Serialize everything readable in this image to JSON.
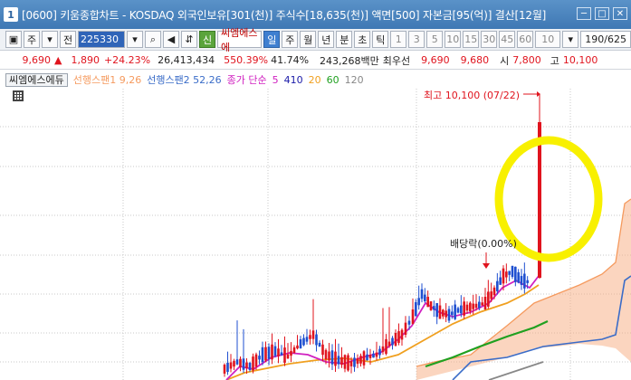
{
  "window": {
    "number": "1",
    "title": "[0600] 키움종합차트 - KOSDAQ 외국인보유[301(천)] 주식수[18,635(천)] 액면[500] 자본금[95(억)] 결산[12월]",
    "buttons": [
      "─",
      "□",
      "✕"
    ]
  },
  "toolbar": {
    "period_selects": [
      "주",
      "전"
    ],
    "stock_code": "225330",
    "stock_name": "씨엠에스에",
    "tag_new": "신",
    "intervals": [
      "일",
      "주",
      "월",
      "년",
      "분",
      "초",
      "틱"
    ],
    "selected_interval": "일",
    "minute_options": [
      "1",
      "3",
      "5",
      "10",
      "15",
      "30",
      "45",
      "60"
    ],
    "custom_minutes": "10",
    "count": "190",
    "count_total": "/625"
  },
  "quote": {
    "price": "9,690",
    "arrow": "▲",
    "change": "1,890",
    "change_pct": "+24.23%",
    "volume": "26,413,434",
    "volume_ratio": "550.39%",
    "turnover": "41.74%",
    "amount": "243,268백만",
    "best_ask_label": "최우선",
    "best_ask": "9,690",
    "best_bid": "9,680",
    "open_label": "시",
    "open": "7,800",
    "high_label": "고",
    "high": "10,100"
  },
  "legend": {
    "stock_button": "씨엠에스에듀",
    "span1": "선행스팬1 9,26",
    "span2": "선행스팬2 52,26",
    "ma_label": "종가 단순",
    "ma_periods": [
      "5",
      "410",
      "20",
      "60",
      "120"
    ],
    "colors": {
      "span1": "#f59a5e",
      "span2": "#3a6cc8",
      "ma_label": "#d020c0",
      "ma5": "#d020c0",
      "ma410": "#1a1aa8",
      "ma20": "#f0a020",
      "ma60": "#20a020",
      "ma120": "#888888"
    }
  },
  "annotations": {
    "high": "최고 10,100 (07/22)",
    "dividend": "배당락(0.00%)"
  },
  "colors": {
    "title_bar": "#4a84c0",
    "up_candle": "#e0141e",
    "down_candle": "#1e4fd0",
    "highlight_circle": "#f8f000",
    "cloud": "#f7b28a"
  },
  "chart_data": {
    "type": "candlestick",
    "title": "",
    "recent_closes": [
      7200,
      7300,
      7250,
      7400,
      7450,
      7500,
      7600,
      7550,
      7700,
      7800,
      9690
    ],
    "last_high": 10100,
    "last_open": 7800,
    "last_close": 9690
  }
}
